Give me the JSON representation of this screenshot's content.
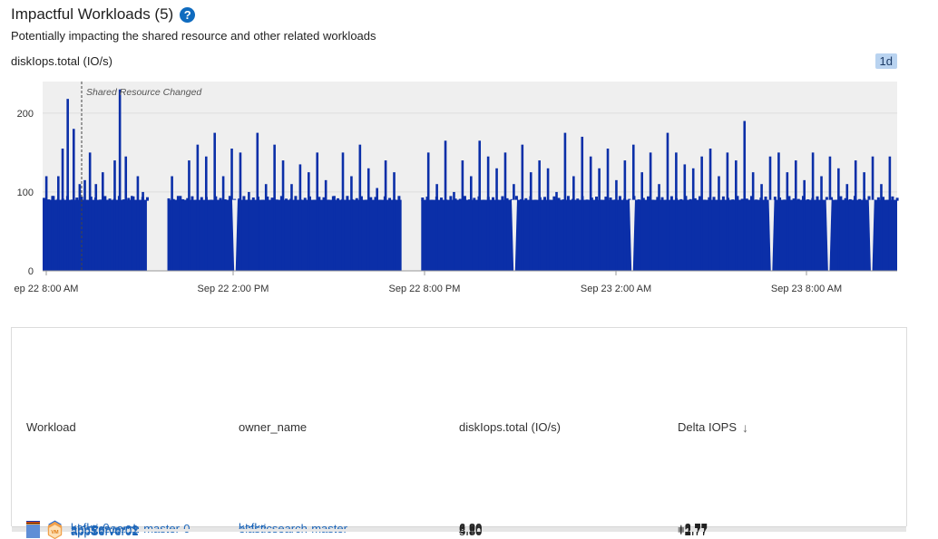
{
  "header": {
    "title": "Impactful Workloads (5)",
    "help_glyph": "?",
    "subtitle": "Potentially impacting the shared resource and other related workloads",
    "metric_label": "diskIops.total (IO/s)",
    "time_range": "1d"
  },
  "chart_data": {
    "type": "area",
    "series": [
      {
        "color": "#0b2fa8"
      }
    ],
    "ylim": [
      0,
      240
    ],
    "y_ticks": [
      "0",
      "100",
      "200"
    ],
    "x_ticks": [
      "ep 22 8:00 AM",
      "Sep 22 2:00 PM",
      "Sep 22 8:00 PM",
      "Sep 23 2:00 AM",
      "Sep 23 8:00 AM"
    ],
    "annotation": {
      "label": "Shared Resource Changed"
    },
    "grid": true,
    "baseline_level": 90,
    "spikes": [
      [
        0.3,
        120
      ],
      [
        1.0,
        95
      ],
      [
        1.7,
        120
      ],
      [
        2.2,
        155
      ],
      [
        2.8,
        218
      ],
      [
        3.5,
        180
      ],
      [
        4.2,
        110
      ],
      [
        4.8,
        115
      ],
      [
        5.4,
        150
      ],
      [
        6.1,
        110
      ],
      [
        6.9,
        125
      ],
      [
        7.6,
        90
      ],
      [
        8.3,
        140
      ],
      [
        8.9,
        230
      ],
      [
        9.6,
        145
      ],
      [
        10.3,
        95
      ],
      [
        11.0,
        120
      ],
      [
        11.6,
        100
      ],
      [
        15.0,
        120
      ],
      [
        16.0,
        95
      ],
      [
        17.0,
        140
      ],
      [
        18.0,
        160
      ],
      [
        19.0,
        145
      ],
      [
        20.0,
        175
      ],
      [
        21.0,
        120
      ],
      [
        22.0,
        155
      ],
      [
        23.0,
        150
      ],
      [
        24.0,
        100
      ],
      [
        25.0,
        175
      ],
      [
        26.0,
        110
      ],
      [
        27.0,
        160
      ],
      [
        28.0,
        140
      ],
      [
        29.0,
        110
      ],
      [
        30.0,
        135
      ],
      [
        31.0,
        125
      ],
      [
        32.0,
        150
      ],
      [
        33.0,
        115
      ],
      [
        34.0,
        95
      ],
      [
        35.0,
        150
      ],
      [
        36.0,
        120
      ],
      [
        37.0,
        160
      ],
      [
        38.0,
        130
      ],
      [
        39.0,
        105
      ],
      [
        40.0,
        140
      ],
      [
        41.0,
        125
      ],
      [
        45.0,
        150
      ],
      [
        46.0,
        110
      ],
      [
        47.0,
        165
      ],
      [
        48.0,
        100
      ],
      [
        49.0,
        140
      ],
      [
        50.0,
        120
      ],
      [
        51.0,
        165
      ],
      [
        52.0,
        145
      ],
      [
        53.0,
        130
      ],
      [
        54.0,
        150
      ],
      [
        55.0,
        110
      ],
      [
        56.0,
        160
      ],
      [
        57.0,
        125
      ],
      [
        58.0,
        140
      ],
      [
        59.0,
        130
      ],
      [
        60.0,
        100
      ],
      [
        61.0,
        175
      ],
      [
        62.0,
        120
      ],
      [
        63.0,
        170
      ],
      [
        64.0,
        145
      ],
      [
        65.0,
        130
      ],
      [
        66.0,
        155
      ],
      [
        67.0,
        115
      ],
      [
        68.0,
        140
      ],
      [
        69.0,
        160
      ],
      [
        70.0,
        125
      ],
      [
        71.0,
        150
      ],
      [
        72.0,
        110
      ],
      [
        73.0,
        175
      ],
      [
        74.0,
        150
      ],
      [
        75.0,
        135
      ],
      [
        76.0,
        130
      ],
      [
        77.0,
        145
      ],
      [
        78.0,
        155
      ],
      [
        79.0,
        120
      ],
      [
        80.0,
        150
      ],
      [
        81.0,
        140
      ],
      [
        82.0,
        190
      ],
      [
        83.0,
        125
      ],
      [
        84.0,
        110
      ],
      [
        85.0,
        145
      ],
      [
        86.0,
        150
      ],
      [
        87.0,
        125
      ],
      [
        88.0,
        140
      ],
      [
        89.0,
        115
      ],
      [
        90.0,
        150
      ],
      [
        91.0,
        120
      ],
      [
        92.0,
        145
      ],
      [
        93.0,
        130
      ],
      [
        94.0,
        110
      ],
      [
        95.0,
        140
      ],
      [
        96.0,
        125
      ],
      [
        97.0,
        145
      ],
      [
        98.0,
        110
      ],
      [
        99.0,
        145
      ]
    ],
    "gaps": [
      [
        12.2,
        14.6
      ],
      [
        42.0,
        44.3
      ]
    ],
    "dips": [
      22.5,
      42.6,
      55.2,
      69.0,
      85.3,
      92.0,
      97.0
    ]
  },
  "table": {
    "headers": [
      "Workload",
      "owner_name",
      "diskIops.total (IO/s)",
      "Delta IOPS"
    ],
    "sort_glyph": "↓",
    "rows": [
      {
        "color": "#0b2fa8",
        "icon": "pod-icon",
        "icon_text": "Pd",
        "workload": "kafka-0",
        "owner": "kafka",
        "iops": "6.80",
        "delta": "+2.77"
      },
      {
        "color": "#f25a18",
        "icon": "pod-icon",
        "icon_text": "Pd",
        "workload": "elasticsearch-master-0",
        "owner": "elasticsearch-master",
        "iops": "6.80",
        "delta": "+2.77"
      },
      {
        "color": "#4a1300",
        "icon": "vm-icon",
        "icon_text": "VM",
        "workload": "appServer03",
        "owner": "",
        "iops": "6.80",
        "delta": "+2.77"
      },
      {
        "color": "#f59a2a",
        "icon": "vm-icon",
        "icon_text": "VM",
        "workload": "appServer02",
        "owner": "",
        "iops": "4.80",
        "delta": "+2.77"
      },
      {
        "color": "#5f8ed6",
        "icon": "vm-icon",
        "icon_text": "VM",
        "workload": "appServer01",
        "owner": "",
        "iops": "5.80",
        "delta": "+2.77"
      }
    ]
  }
}
